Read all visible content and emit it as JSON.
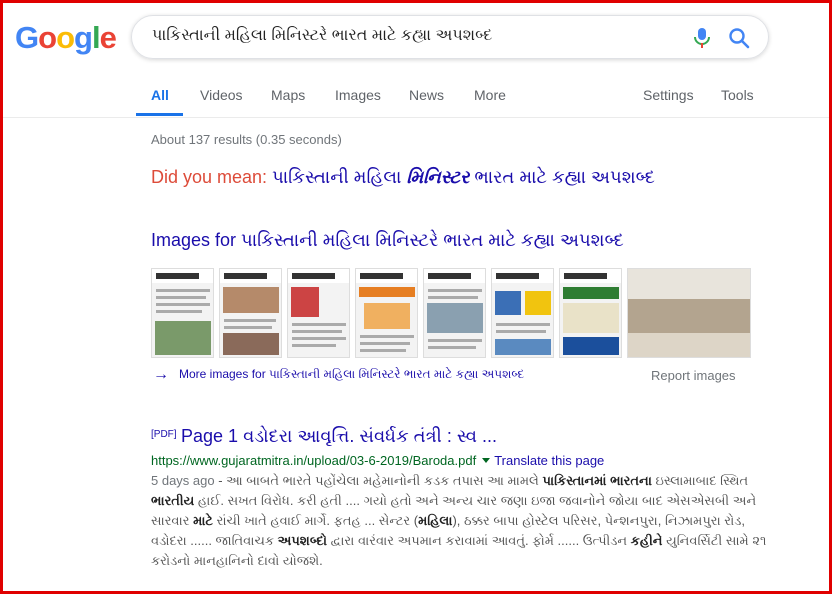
{
  "logo": {
    "letters": [
      "G",
      "o",
      "o",
      "g",
      "l",
      "e"
    ]
  },
  "search": {
    "query": "પાકિસ્તાની મહિલા મિનિસ્ટરે ભારત માટે કહ્યા અપશબ્દ"
  },
  "tabs": [
    "All",
    "Videos",
    "Maps",
    "Images",
    "News",
    "More"
  ],
  "tools": {
    "settings": "Settings",
    "tools": "Tools"
  },
  "stats": "About 137 results (0.35 seconds)",
  "did_you_mean": {
    "label": "Did you mean:",
    "pre": "પાકિસ્તાની મહિલા ",
    "emph": "મિનિસ્ટર",
    "post": " ભારત માટે કહ્યા અપશબ્દ"
  },
  "images": {
    "heading": "Images for પાકિસ્તાની મહિલા મિનિસ્ટરે ભારત માટે કહ્યા અપશબ્દ",
    "more_label": "More images for પાકિસ્તાની મહિલા મિનિસ્ટરે ભારત માટે કહ્યા અપશબ્દ",
    "report": "Report images"
  },
  "result": {
    "badge": "[PDF]",
    "title": "Page 1 વડોદરા આવૃત્તિ. સંવર્ધક તંત્રી : સ્વ ...",
    "url": "https://www.gujaratmitra.in/upload/03-6-2019/Baroda.pdf",
    "translate": "Translate this page",
    "date": "5 days ago",
    "snippet_1": " - આ બાબતે ભારતે પહોંચેલા મહેમાનોની કડક તપાસ આ મામલે ",
    "snippet_b1": "પાકિસ્તાનમાં ભારતના",
    "snippet_2": " ઇસ્લામાબાદ સ્થિત ",
    "snippet_b2": "ભારતીય",
    "snippet_3": " હાઈ. સખત વિરોધ. કરી હતી .... ગયો હતો અને અન્ય ચાર જણા ઇજા જવાનોને જોયા બાદ એસએસબી અને સારવાર ",
    "snippet_b3": "માટે",
    "snippet_4": " રાંચી ખાતે હવાઈ માર્ગે. ફતહ ... સેન્ટર (",
    "snippet_b4": "મહિલા",
    "snippet_5": "), ઠક્કર બાપા હોસ્ટેલ પરિસર, પેન્શનપુરા, નિઝામપુરા રોડ, વડોદરા ...... જાતિવાચક ",
    "snippet_b5": "અપશબ્દો",
    "snippet_6": " દ્વારા વારંવાર અપમાન કરાવામાં આવતું. ફોર્મ ...... ઉત્પીડન ",
    "snippet_b6": "કહીને",
    "snippet_7": " યુનિવર્સિટી સામે ૨૧ કરોડનો માનહાનિનો દાવો યોજશે."
  },
  "colors": {
    "link": "#1a0dab",
    "url": "#006621",
    "accent": "#1a73e8",
    "frame": "#e00000"
  }
}
